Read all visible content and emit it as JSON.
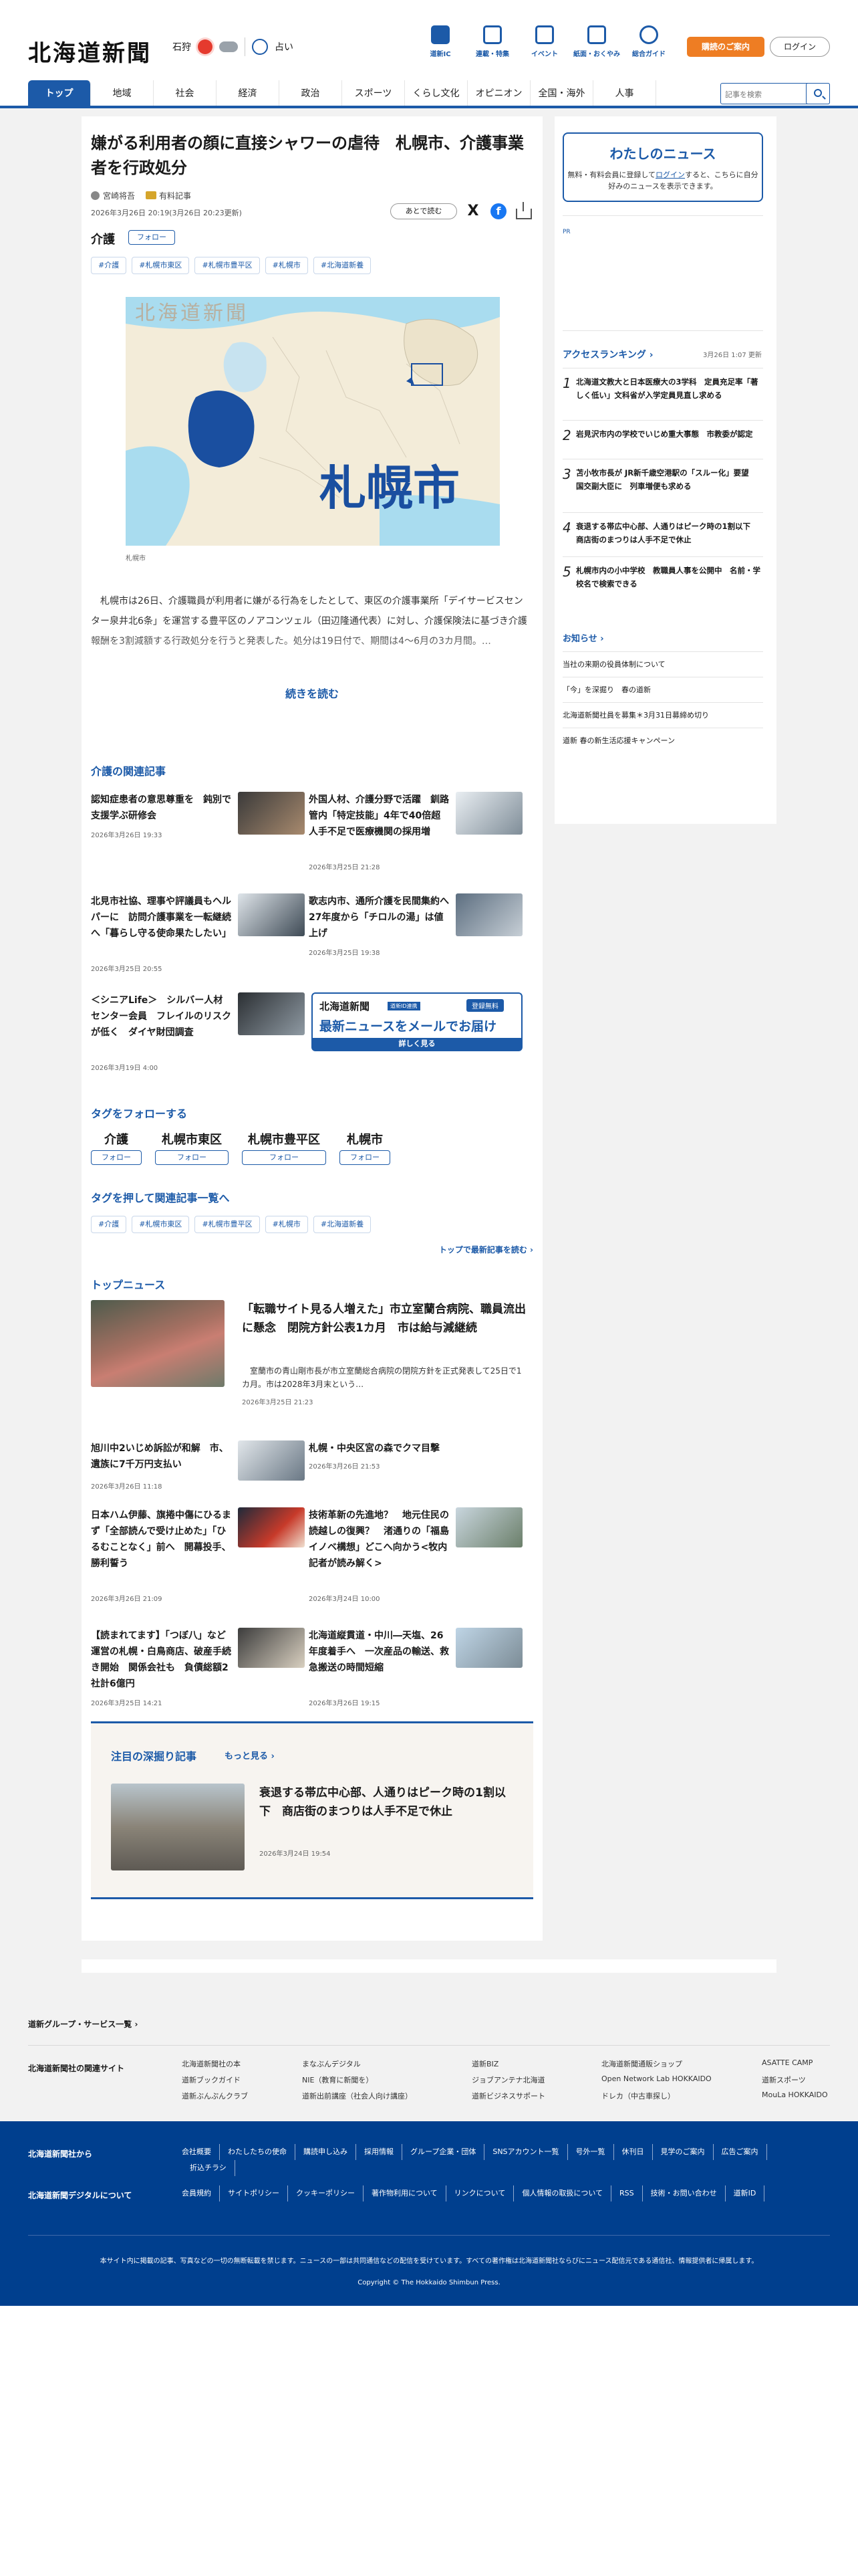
{
  "header": {
    "logo": "北海道新聞",
    "weather_city": "石狩",
    "fortune_label": "占い",
    "services": [
      {
        "label": "道新IC"
      },
      {
        "label": "連載・特集"
      },
      {
        "label": "イベント"
      },
      {
        "label": "紙面・おくやみ"
      },
      {
        "label": "総合ガイド"
      }
    ],
    "join_label": "購読のご案内",
    "login_label": "ログイン"
  },
  "categories": [
    "トップ",
    "地域",
    "社会",
    "経済",
    "政治",
    "スポーツ",
    "くらし文化",
    "オピニオン",
    "全国・海外",
    "人事"
  ],
  "search": {
    "placeholder": "記事を検索"
  },
  "article": {
    "headline": "嫌がる利用者の顔に直接シャワーの虐待　札幌市、介護事業者を行政処分",
    "author": "宮崎将吾",
    "member_badge": "有料記事",
    "dateline": "2026年3月26日 20:19(3月26日 20:23更新)",
    "later_label": "あとで読む",
    "tag_main": "介護",
    "follow_label": "フォロー",
    "tags": [
      "#介護",
      "#札幌市東区",
      "#札幌市豊平区",
      "#札幌市",
      "#北海道新養"
    ],
    "map_watermark": "北海道新聞",
    "map_label": "札幌市",
    "map_credit": "札幌市",
    "lead": "　札幌市は26日、介護職員が利用者に嫌がる行為をしたとして、東区の介護事業所「デイサービスセンター泉井北6条」を運営する豊平区のノアコンツェル（田辺隆通代表）に対し、介護保険法に基づき介護報酬を3割減額する行政処分を行うと発表した。処分は19日付で、期間は4～6月の3カ月間。…",
    "readmore_label": "続きを読む"
  },
  "related": {
    "title": "介護の関連記事",
    "items": [
      {
        "title": "認知症患者の意思尊重を　鈍別で支援学ぶ研修会",
        "date": "2026年3月26日 19:33"
      },
      {
        "title": "外国人材、介護分野で活躍　釧路管内「特定技能」4年で40倍超　人手不足で医療機関の採用増",
        "date": "2026年3月25日 21:28"
      },
      {
        "title": "北見市社協、理事や評議員もヘルパーに　訪問介護事業を一転継続へ「暮らし守る使命果たしたい」",
        "date": "2026年3月25日 20:55"
      },
      {
        "title": "歌志内市、通所介護を民間集約へ　27年度から「チロルの湯」は値上げ",
        "date": "2026年3月25日 19:38"
      },
      {
        "title": "＜シニアLife＞　シルバー人材センター会員　フレイルのリスクが低く　ダイヤ財団調査",
        "date": "2026年3月19日 4:00"
      }
    ],
    "mail_banner": {
      "logo": "北海道新聞",
      "sub": "道新ID連携",
      "badge": "登録無料",
      "headline": "最新ニュースをメールでお届け",
      "cta": "詳しく見る"
    }
  },
  "follow_tags": {
    "title": "タグをフォローする",
    "items": [
      "介護",
      "札幌市東区",
      "札幌市豊平区",
      "札幌市"
    ],
    "button": "フォロー"
  },
  "tag_list": {
    "title": "タグを押して関連記事一覧へ",
    "items": [
      "#介護",
      "#札幌市東区",
      "#札幌市豊平区",
      "#札幌市",
      "#北海道新養"
    ],
    "latest_link": "トップで最新記事を読む"
  },
  "top_news": {
    "title": "トップニュース",
    "lead": {
      "title": "「転職サイト見る人増えた」市立室蘭合病院、職員流出に懸念　閉院方針公表1カ月　市は給与減継続",
      "summary": "　室蘭市の青山剛市長が市立室蘭総合病院の閉院方針を正式発表して25日で1カ月。市は2028年3月末という…",
      "date": "2026年3月25日 21:23"
    },
    "items": [
      {
        "title": "旭川中2いじめ訴訟が和解　市、遺族に7千万円支払い",
        "date": "2026年3月26日 11:18"
      },
      {
        "title": "札幌・中央区宮の森でクマ目撃",
        "date": "2026年3月26日 21:53"
      },
      {
        "title": "日本ハム伊藤、旗捲中傷にひるまず「全部読んで受け止めた」「ひるむことなく」前へ　開幕投手、勝利誓う",
        "date": "2026年3月26日 21:09"
      },
      {
        "title": "技術革新の先進地？　地元住民の読越しの復興？　渚通りの「福島イノベ構想」どこへ向かう<牧内記者が読み解く>",
        "date": "2026年3月24日 10:00"
      },
      {
        "title": "【読まれてます】「つぼ八」など運営の札幌・白鳥商店、破産手続き開始　関係会社も　負債総額2社計6億円",
        "date": "2026年3月25日 14:21"
      },
      {
        "title": "北海道縦貫道・中川―天塩、26年度着手へ　一次産品の輸送、救急搬送の時間短縮",
        "date": "2026年3月26日 19:15"
      }
    ]
  },
  "deep_dive": {
    "title": "注目の深掘り記事",
    "more": "もっと見る",
    "article": {
      "title": "衰退する帯広中心部、人通りはピーク時の1割以下　商店街のまつりは人手不足で休止",
      "date": "2026年3月24日 19:54"
    }
  },
  "sidebar": {
    "mynews": {
      "title": "わたしのニュース",
      "text_before": "無料・有料会員に登録して",
      "login_link": "ログイン",
      "text_after": "すると、こちらに自分好みのニュースを表示できます。"
    },
    "pr_label": "PR",
    "ranking": {
      "title": "アクセスランキング",
      "updated": "3月26日 1:07 更新",
      "items": [
        {
          "num": "1",
          "title": "北海道文教大と日本医療大の3学科　定員充足率「著しく低い」文科省が入学定員見直し求める"
        },
        {
          "num": "2",
          "title": "岩見沢市内の学校でいじめ重大事態　市教委が認定"
        },
        {
          "num": "3",
          "title": "苫小牧市長が JR新千歳空港駅の「スルー化」要望　国交副大臣に　列車増便も求める"
        },
        {
          "num": "4",
          "title": "衰退する帯広中心部、人通りはピーク時の1割以下　商店街のまつりは人手不足で休止"
        },
        {
          "num": "5",
          "title": "札幌市内の小中学校　教職員人事を公開中　名前・学校名で検索できる"
        }
      ]
    },
    "notice": {
      "title": "お知らせ",
      "items": [
        "当社の来期の役員体制について",
        "「今」を深掘り　春の道新",
        "北海道新聞社員を募集＊3月31日募締め切り",
        "道新 春の新生活応援キャンペーン"
      ]
    }
  },
  "footer": {
    "group_link": "道新グループ・サービス一覧",
    "related_sites_title": "北海道新聞社の関連サイト",
    "related_sites": [
      [
        "北海道新聞社の本",
        "道新ブックガイド",
        "道新ぶんぷんクラブ"
      ],
      [
        "まなぶんデジタル",
        "NIE（教育に新聞を）",
        "道新出前講座（社会人向け講座）"
      ],
      [
        "道新BIZ",
        "ジョブアンテナ北海道",
        "道新ビジネスサポート"
      ],
      [
        "北海道新聞通販ショップ",
        "Open Network Lab HOKKAIDO",
        "ドレカ（中古車探し）"
      ],
      [
        "ASATTE CAMP",
        "道新スポーツ",
        "MouLa HOKKAIDO"
      ]
    ],
    "company_title": "北海道新聞社から",
    "company_links": [
      "会社概要",
      "わたしたちの使命",
      "購読申し込み",
      "採用情報",
      "グループ企業・団体",
      "SNSアカウント一覧",
      "号外一覧",
      "休刊日",
      "見学のご案内",
      "広告ご案内",
      "折込チラシ"
    ],
    "digital_title": "北海道新聞デジタルについて",
    "digital_links": [
      "会員規約",
      "サイトポリシー",
      "クッキーポリシー",
      "著作物利用について",
      "リンクについて",
      "個人情報の取扱について",
      "RSS",
      "技術・お問い合わせ",
      "道新ID"
    ],
    "notice": "本サイト内に掲載の記事、写真などの一切の無断転載を禁じます。ニュースの一部は共同通信などの配信を受けています。すべての著作権は北海道新聞社ならびにニュース配信元である通信社、情報提供者に帰属します。",
    "copyright": "Copyright © The Hokkaido Shimbun Press."
  }
}
